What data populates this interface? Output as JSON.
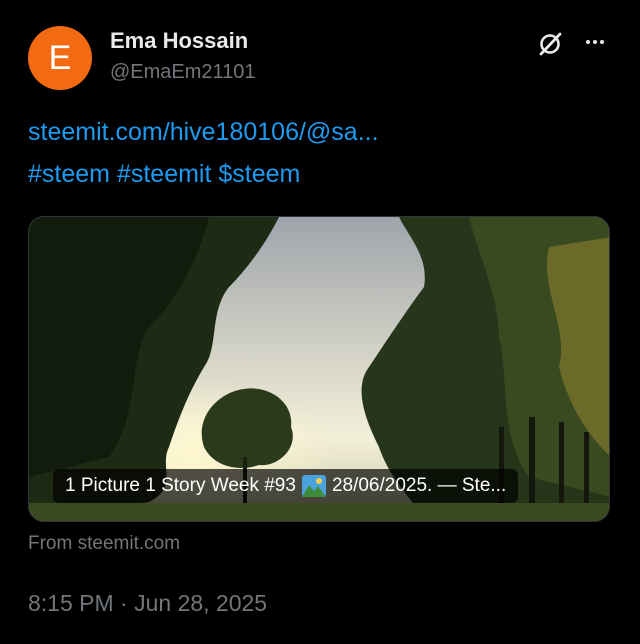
{
  "author": {
    "avatar_letter": "E",
    "avatar_color": "#f26b12",
    "display_name": "Ema Hossain",
    "handle": "@EmaEm21101"
  },
  "header_icons": {
    "grok": "grok-icon",
    "more": "more-icon"
  },
  "body": {
    "link": "steemit.com/hive180106/@sa...",
    "tags": [
      "#steem",
      "#steemit",
      "$steem"
    ]
  },
  "card": {
    "title_before": "1 Picture 1 Story Week #93",
    "title_emoji": "sunrise-landscape-emoji",
    "title_after": "28/06/2025. — Ste...",
    "source": "From steemit.com"
  },
  "timestamp": "8:15 PM · Jun 28, 2025",
  "colors": {
    "background": "#000000",
    "link": "#1d9bf0",
    "muted": "#71767b",
    "text": "#e7e9ea"
  }
}
